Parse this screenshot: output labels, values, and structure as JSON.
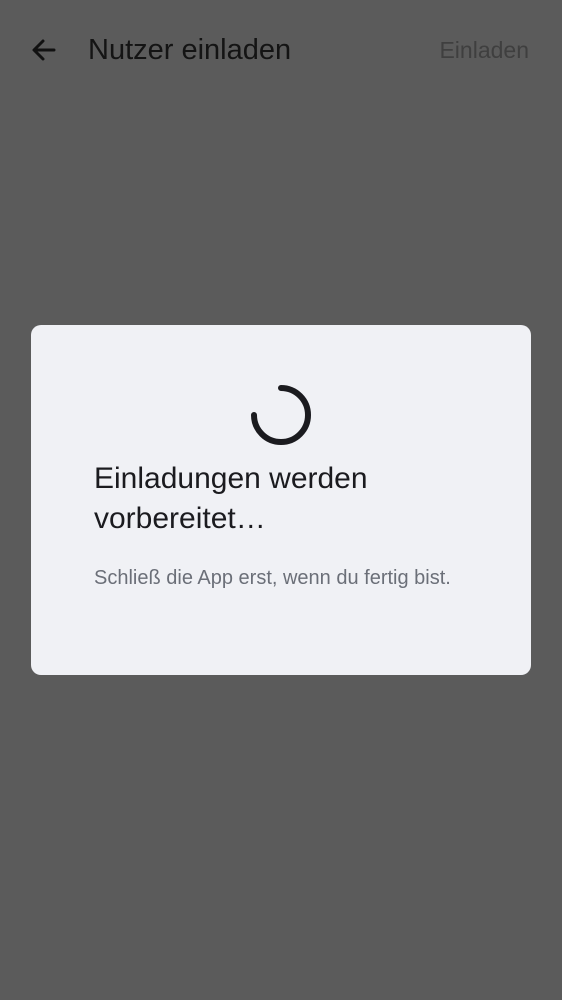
{
  "appbar": {
    "title": "Nutzer einladen",
    "action_label": "Einladen",
    "back_icon": "arrow-left-icon"
  },
  "dialog": {
    "title": "Einladungen werden vorbereitet…",
    "body": "Schließ die App erst, wenn du fertig bist.",
    "spinner_icon": "loading-spinner-icon"
  },
  "colors": {
    "scrim_background": "#5b5b5b",
    "dialog_background": "#f0f1f5",
    "title_text": "#141414",
    "body_text": "#6b6f78"
  }
}
